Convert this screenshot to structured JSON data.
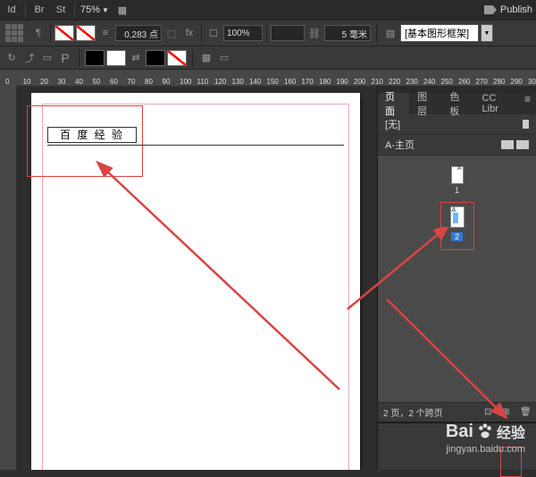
{
  "topbar": {
    "zoom_value": "75%",
    "publish_label": "Publish"
  },
  "control": {
    "stroke_pt": "0.283 点",
    "opacity": "100%",
    "size_mm": "5 毫米",
    "frame_preset": "[基本图形框架]"
  },
  "ruler_ticks": [
    "0",
    "10",
    "20",
    "30",
    "40",
    "50",
    "60",
    "70",
    "80",
    "90",
    "100",
    "110",
    "120",
    "130",
    "140",
    "150",
    "160",
    "170",
    "180",
    "190",
    "200",
    "210",
    "220",
    "230",
    "240",
    "250",
    "260",
    "270",
    "280",
    "290",
    "300"
  ],
  "document": {
    "title_text": "百 度 经 验"
  },
  "panel": {
    "tabs": {
      "pages": "页面",
      "layers": "图层",
      "swatches": "色板",
      "cclib": "CC Libr"
    },
    "none_label": "[无]",
    "master_label": "A-主页",
    "master_badge": "A",
    "master_thumb_num": "1",
    "selected_badge": "A",
    "selected_num": "2",
    "footer_text": "2 页，2 个跨页"
  },
  "watermark": {
    "brand": "Bai",
    "brand2": "经验",
    "url": "jingyan.baidu.com"
  }
}
